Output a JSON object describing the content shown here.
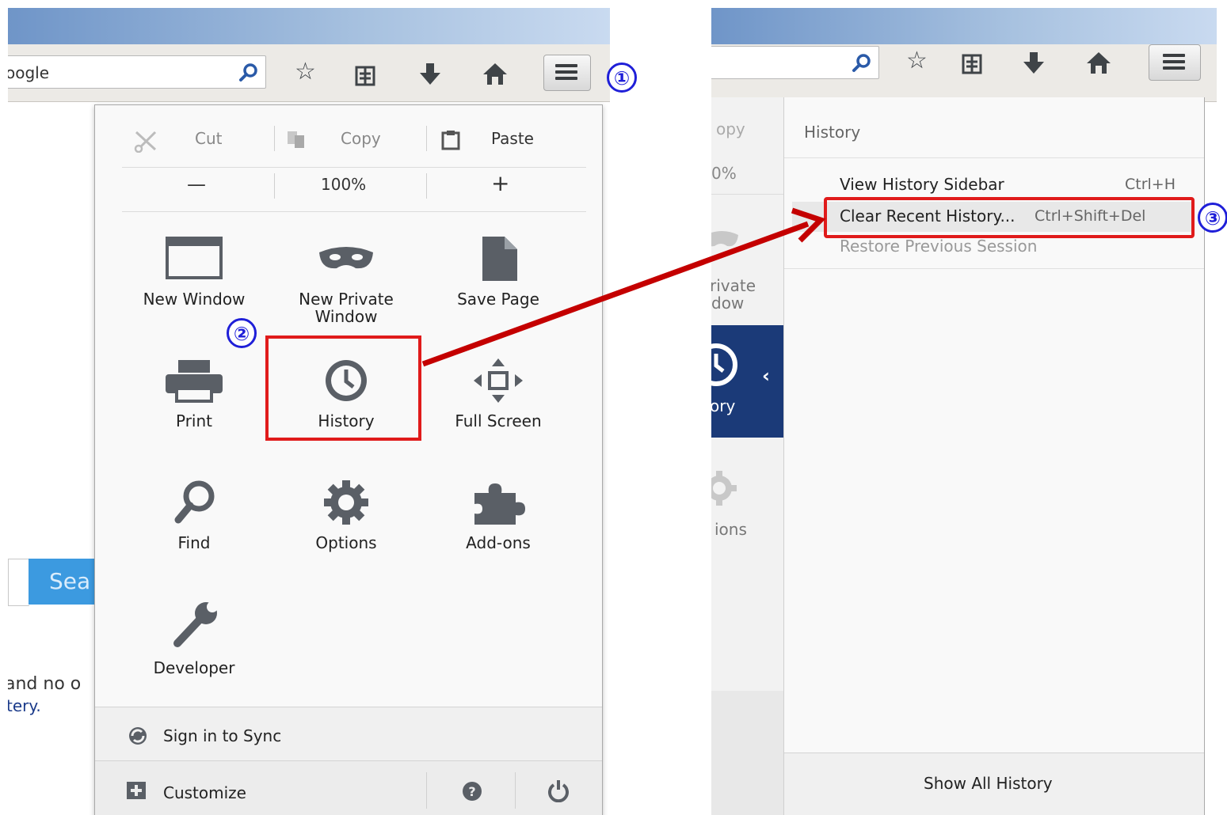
{
  "left": {
    "url_text": "oogle",
    "edit": {
      "cut": "Cut",
      "copy": "Copy",
      "paste": "Paste"
    },
    "zoom": {
      "minus": "—",
      "level": "100%",
      "plus": "+"
    },
    "grid": [
      {
        "label": "New Window"
      },
      {
        "label": "New Private Window"
      },
      {
        "label": "Save Page"
      },
      {
        "label": "Print"
      },
      {
        "label": "History"
      },
      {
        "label": "Full Screen"
      },
      {
        "label": "Find"
      },
      {
        "label": "Options"
      },
      {
        "label": "Add-ons"
      },
      {
        "label": "Developer"
      }
    ],
    "sign_in": "Sign in to Sync",
    "customize": "Customize",
    "page_fragments": {
      "search_button": "Sea",
      "text_line1": "and no o",
      "text_line2": "tery."
    }
  },
  "right": {
    "bg_fragments": {
      "copy": "opy",
      "zoom": "0%",
      "private_1": "rivate",
      "private_2": "dow",
      "history": "ory",
      "options": "ions"
    },
    "history_title": "History",
    "items": [
      {
        "label": "View History Sidebar",
        "shortcut": "Ctrl+H"
      },
      {
        "label": "Clear Recent History...",
        "shortcut": "Ctrl+Shift+Del"
      },
      {
        "label": "Restore Previous Session",
        "shortcut": ""
      }
    ],
    "show_all": "Show All History"
  },
  "annotations": {
    "step1": "①",
    "step2": "②",
    "step3": "③"
  },
  "colors": {
    "highlight_red": "#e01b1b",
    "step_blue": "#1f1fd8",
    "arrow": "#c40000",
    "history_selected": "#1b3a78"
  }
}
